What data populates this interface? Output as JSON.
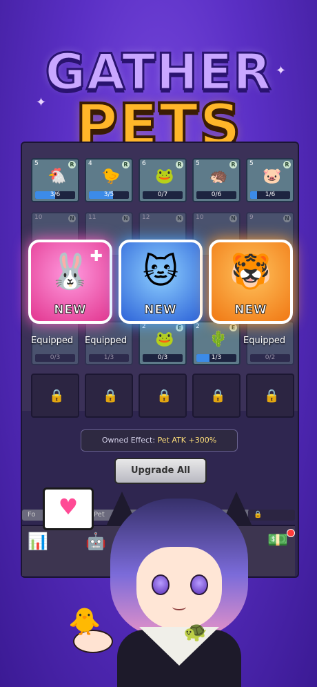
{
  "title": {
    "line1": "GATHER",
    "line2": "PETS"
  },
  "grid": {
    "row1": [
      {
        "level": "5",
        "rank": "R",
        "pet": "🐔",
        "progress": "3/6",
        "fill": 0.5
      },
      {
        "level": "4",
        "rank": "R",
        "pet": "🐤",
        "progress": "3/5",
        "fill": 0.6
      },
      {
        "level": "6",
        "rank": "R",
        "pet": "🐸",
        "progress": "0/7",
        "fill": 0
      },
      {
        "level": "5",
        "rank": "R",
        "pet": "🦔",
        "progress": "0/6",
        "fill": 0
      },
      {
        "level": "5",
        "rank": "R",
        "pet": "🐷",
        "progress": "1/6",
        "fill": 0.17
      }
    ],
    "row2": [
      {
        "level": "10",
        "rank": "N"
      },
      {
        "level": "11",
        "rank": "N"
      },
      {
        "level": "12",
        "rank": "N"
      },
      {
        "level": "10",
        "rank": "N"
      },
      {
        "level": "9",
        "rank": "N"
      }
    ],
    "row3": [
      {
        "progress": "0/3",
        "label": "Equipped"
      },
      {
        "progress": "1/3",
        "label": "Equipped"
      },
      {
        "level": "2",
        "rank": "E",
        "pet": "🐸",
        "progress": "0/3",
        "fill": 0
      },
      {
        "level": "2",
        "rank": "E",
        "pet": "🌵",
        "progress": "1/3",
        "fill": 0.33
      },
      {
        "progress": "0/2",
        "label": "Equipped"
      }
    ]
  },
  "new_cards": [
    {
      "pet": "🐰",
      "label": "NEW",
      "theme": "pink"
    },
    {
      "pet": "🐱",
      "label": "NEW",
      "theme": "blue"
    },
    {
      "pet": "🐯",
      "label": "NEW",
      "theme": "orange"
    }
  ],
  "owned_effect": {
    "prefix": "Owned Effect: ",
    "highlight": "Pet ATK +300%"
  },
  "upgrade_button": "Upgrade All",
  "tabs": [
    {
      "label": "Fo"
    },
    {
      "label": "Pet"
    }
  ],
  "bubble_icon": "heart-icon",
  "colors": {
    "accent": "#ffb629",
    "bar": "#3c8be8"
  }
}
